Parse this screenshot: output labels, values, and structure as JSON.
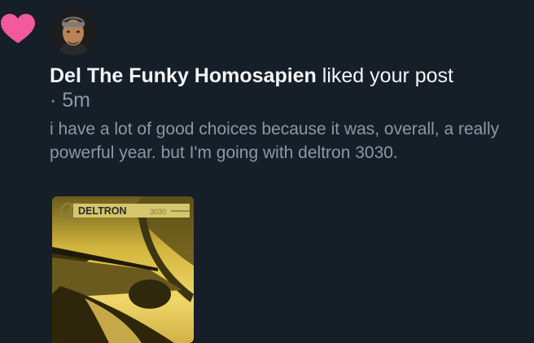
{
  "notification": {
    "author": "Del The Funky Homosapien",
    "action": "liked your post",
    "separator": "·",
    "time": "5m",
    "excerpt": "i have a lot of good choices because it was, overall, a really powerful year. but I'm going with deltron 3030.",
    "heart_icon": "heart-icon",
    "heart_color": "#f4599b"
  },
  "album": {
    "title_main": "DELTRON",
    "title_sub": "3030"
  },
  "colors": {
    "background": "#161e27",
    "primary_text": "#f3f5f7",
    "secondary_text": "#8b98a5"
  }
}
